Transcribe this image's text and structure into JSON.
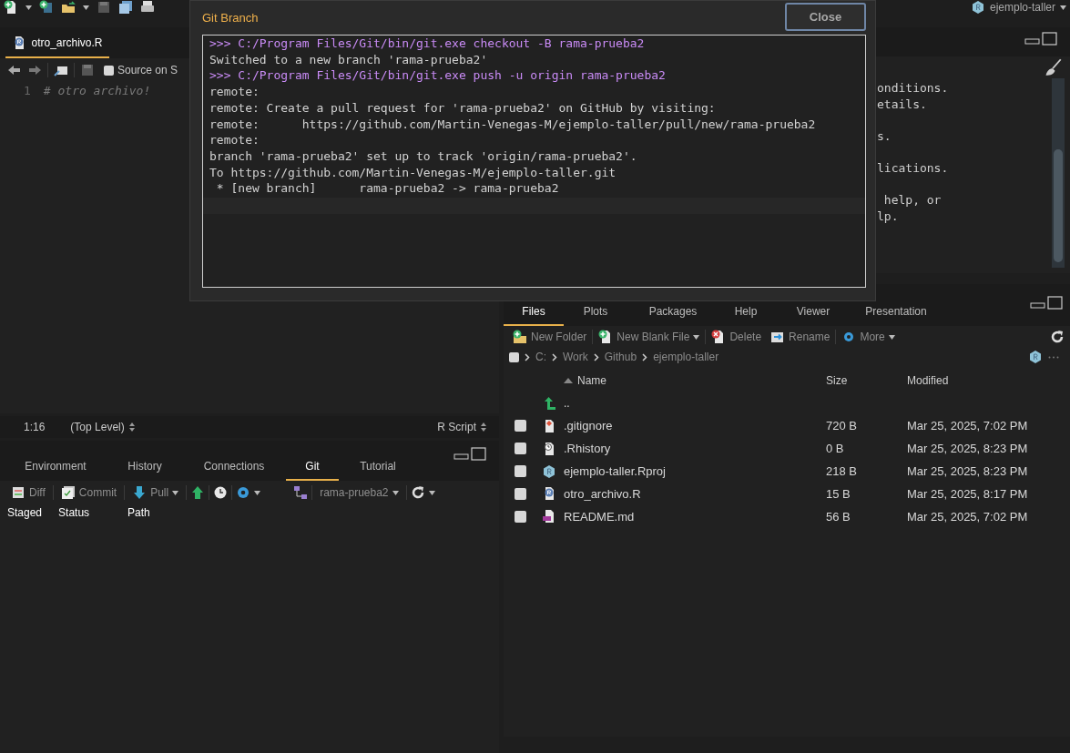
{
  "toolbar": {
    "project": "ejemplo-taller"
  },
  "editor": {
    "tab": {
      "label": "otro_archivo.R",
      "selected": true
    },
    "source_on_save": {
      "label": "Source on S",
      "checked": false
    },
    "lines": [
      {
        "number": "1",
        "code": "# otro archivo!"
      }
    ],
    "status": {
      "position": "1:16",
      "scope": "(Top Level)",
      "type": "R Script"
    }
  },
  "git_pane": {
    "tabs": [
      {
        "label": "Environment",
        "selected": false
      },
      {
        "label": "History",
        "selected": false
      },
      {
        "label": "Connections",
        "selected": false
      },
      {
        "label": "Git",
        "selected": true
      },
      {
        "label": "Tutorial",
        "selected": false
      }
    ],
    "toolbar": {
      "diff": "Diff",
      "commit": "Commit",
      "pull": "Pull",
      "branch": "rama-prueba2"
    },
    "columns": [
      "Staged",
      "Status",
      "Path"
    ]
  },
  "console": {
    "paragraphs": [
      [
        "onditions.",
        "etails."
      ],
      [
        "s."
      ],
      [
        "lications."
      ],
      [
        " help, or",
        "lp."
      ]
    ]
  },
  "files_pane": {
    "tabs": [
      {
        "label": "Files",
        "selected": true
      },
      {
        "label": "Plots",
        "selected": false
      },
      {
        "label": "Packages",
        "selected": false
      },
      {
        "label": "Help",
        "selected": false
      },
      {
        "label": "Viewer",
        "selected": false
      },
      {
        "label": "Presentation",
        "selected": false
      }
    ],
    "toolbar": [
      {
        "kind": "folder",
        "label": "New Folder"
      },
      {
        "kind": "file",
        "label": "New Blank File"
      },
      {
        "kind": "delete",
        "label": "Delete"
      },
      {
        "kind": "rename",
        "label": "Rename"
      },
      {
        "kind": "more",
        "label": "More"
      }
    ],
    "select_all": {
      "checked": false
    },
    "breadcrumb": [
      "C:",
      "Work",
      "Github",
      "ejemplo-taller"
    ],
    "columns": [
      "Name",
      "Size",
      "Modified"
    ],
    "parent": "..",
    "rows": [
      {
        "kind": "git",
        "name": ".gitignore",
        "size": "720 B",
        "modified": "Mar 25, 2025, 7:02 PM",
        "checked": false
      },
      {
        "kind": "history",
        "name": ".Rhistory",
        "size": "0 B",
        "modified": "Mar 25, 2025, 8:23 PM",
        "checked": false
      },
      {
        "kind": "rproj",
        "name": "ejemplo-taller.Rproj",
        "size": "218 B",
        "modified": "Mar 25, 2025, 8:23 PM",
        "checked": false
      },
      {
        "kind": "r",
        "name": "otro_archivo.R",
        "size": "15 B",
        "modified": "Mar 25, 2025, 8:17 PM",
        "checked": false
      },
      {
        "kind": "md",
        "name": "README.md",
        "size": "56 B",
        "modified": "Mar 25, 2025, 7:02 PM",
        "checked": false
      }
    ]
  },
  "dialog": {
    "title": "Git Branch",
    "close": "Close",
    "output": [
      {
        "kind": "command",
        "text": ">>> C:/Program Files/Git/bin/git.exe checkout -B rama-prueba2"
      },
      {
        "kind": "output",
        "text": "Switched to a new branch 'rama-prueba2'"
      },
      {
        "kind": "command",
        "text": ">>> C:/Program Files/Git/bin/git.exe push -u origin rama-prueba2"
      },
      {
        "kind": "output",
        "text": "remote:"
      },
      {
        "kind": "output",
        "text": "remote: Create a pull request for 'rama-prueba2' on GitHub by visiting:"
      },
      {
        "kind": "output",
        "text": "remote:      https://github.com/Martin-Venegas-M/ejemplo-taller/pull/new/rama-prueba2"
      },
      {
        "kind": "output",
        "text": "remote:"
      },
      {
        "kind": "output",
        "text": "branch 'rama-prueba2' set up to track 'origin/rama-prueba2'."
      },
      {
        "kind": "output",
        "text": "To https://github.com/Martin-Venegas-M/ejemplo-taller.git"
      },
      {
        "kind": "output",
        "text": " * [new branch]      rama-prueba2 -> rama-prueba2"
      }
    ]
  }
}
